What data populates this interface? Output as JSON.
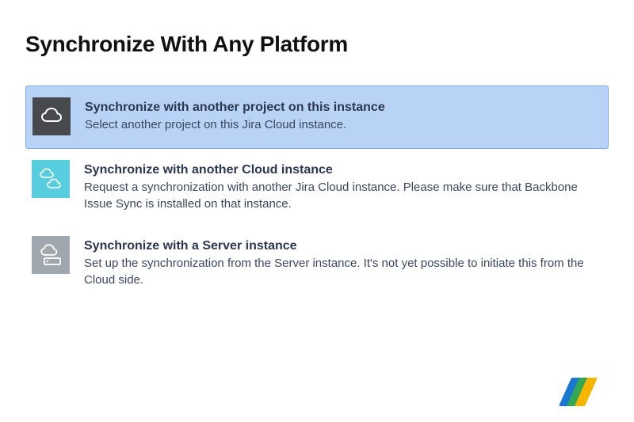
{
  "title": "Synchronize With Any Platform",
  "options": [
    {
      "icon": "cloud-icon",
      "icon_bg": "dark",
      "selected": true,
      "title": "Synchronize with another project on this instance",
      "desc": "Select another project on this Jira Cloud instance."
    },
    {
      "icon": "cloud-pair-icon",
      "icon_bg": "teal",
      "selected": false,
      "title": "Synchronize with another Cloud instance",
      "desc": "Request a synchronization with another Jira Cloud instance. Please make sure that Backbone Issue Sync is installed on that instance."
    },
    {
      "icon": "cloud-server-icon",
      "icon_bg": "grey",
      "selected": false,
      "title": "Synchronize with a Server instance",
      "desc": "Set up the synchronization from the Server instance. It's not yet possible to initiate this from the Cloud side."
    }
  ],
  "logo_colors": [
    "#1977d4",
    "#33a852",
    "#f7b500"
  ]
}
